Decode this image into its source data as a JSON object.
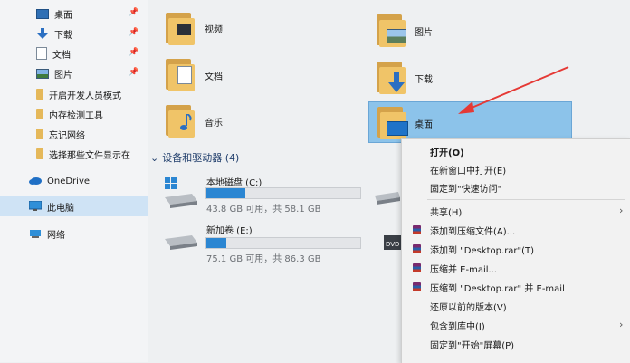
{
  "sidebar": {
    "items": [
      {
        "label": "桌面",
        "pinned": true
      },
      {
        "label": "下载",
        "pinned": true
      },
      {
        "label": "文档",
        "pinned": true
      },
      {
        "label": "图片",
        "pinned": true
      },
      {
        "label": "开启开发人员模式",
        "pinned": false
      },
      {
        "label": "内存检测工具",
        "pinned": false
      },
      {
        "label": "忘记网络",
        "pinned": false
      },
      {
        "label": "选择那些文件显示在",
        "pinned": false
      },
      {
        "label": "OneDrive",
        "pinned": false
      },
      {
        "label": "此电脑",
        "pinned": false,
        "selected": true
      },
      {
        "label": "网络",
        "pinned": false
      }
    ],
    "pin_glyph": "📌"
  },
  "folders": {
    "videos": "视频",
    "documents": "文档",
    "music": "音乐",
    "pictures": "图片",
    "downloads": "下载",
    "desktop": "桌面"
  },
  "devices": {
    "header": "设备和驱动器 (4)",
    "drives": [
      {
        "name": "本地磁盘 (C:)",
        "space": "43.8 GB 可用，共 58.1 GB",
        "used_fraction": 0.25
      },
      {
        "name": "新加卷 (E:)",
        "space": "75.1 GB 可用，共 86.3 GB",
        "used_fraction": 0.13
      }
    ]
  },
  "context_menu": {
    "items": [
      {
        "label": "打开(O)",
        "bold": true
      },
      {
        "label": "在新窗口中打开(E)"
      },
      {
        "label": "固定到\"快速访问\""
      },
      {
        "label": "共享(H)",
        "submenu": true
      },
      {
        "label": "添加到压缩文件(A)...",
        "rar": true
      },
      {
        "label": "添加到 \"Desktop.rar\"(T)",
        "rar": true
      },
      {
        "label": "压缩并 E-mail...",
        "rar": true
      },
      {
        "label": "压缩到 \"Desktop.rar\" 并 E-mail",
        "rar": true
      },
      {
        "label": "还原以前的版本(V)"
      },
      {
        "label": "包含到库中(I)",
        "submenu": true
      },
      {
        "label": "固定到\"开始\"屏幕(P)"
      }
    ]
  },
  "colors": {
    "accent": "#2b86d2",
    "folder": "#f0c468",
    "selection": "#cfe3f5",
    "annotation_arrow": "#e53935"
  }
}
